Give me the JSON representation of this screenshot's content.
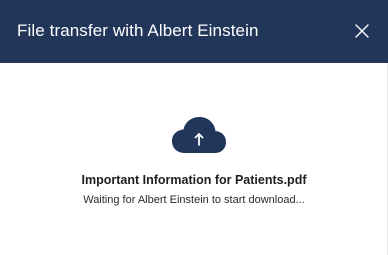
{
  "dialog": {
    "title": "File transfer with Albert Einstein",
    "close_icon": "close-icon"
  },
  "transfer": {
    "icon": "cloud-upload-icon",
    "file_name": "Important Information for Patients.pdf",
    "status": "Waiting for Albert Einstein to start download..."
  },
  "colors": {
    "header_bg": "#22365a",
    "icon": "#22365a",
    "text": "#1e1e1e"
  }
}
